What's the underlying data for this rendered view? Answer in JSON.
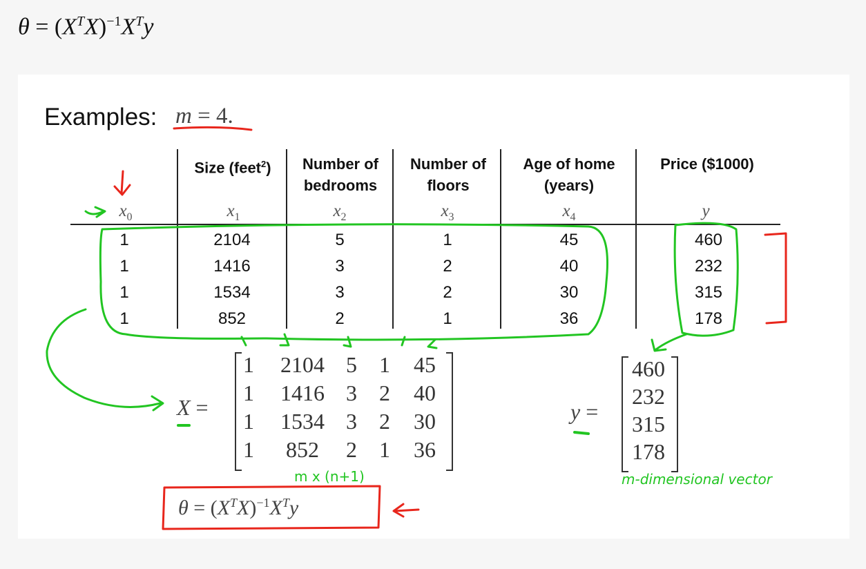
{
  "formula_text": {
    "theta": "θ",
    "eq": " = (",
    "x1": "X",
    "t1": "T",
    "x2": "X",
    "close": ")",
    "inv": "−1",
    "x3": "X",
    "t2": "T",
    "y": "y"
  },
  "slide": {
    "examples_label": "Examples:",
    "m_var": "m",
    "m_eq": " = 4."
  },
  "table": {
    "headers": [
      {
        "line1": "",
        "line2": "",
        "symbol": "x",
        "sub": "0"
      },
      {
        "line1": "Size (feet",
        "sup": "2",
        "line1_end": ")",
        "line2": "",
        "symbol": "x",
        "sub": "1"
      },
      {
        "line1": "Number of",
        "line2": "bedrooms",
        "symbol": "x",
        "sub": "2"
      },
      {
        "line1": "Number of",
        "line2": "floors",
        "symbol": "x",
        "sub": "3"
      },
      {
        "line1": "Age of home",
        "line2": "(years)",
        "symbol": "x",
        "sub": "4"
      },
      {
        "line1": "Price ($1000)",
        "line2": "",
        "symbol": "y",
        "sub": ""
      }
    ],
    "rows": [
      [
        "1",
        "2104",
        "5",
        "1",
        "45",
        "460"
      ],
      [
        "1",
        "1416",
        "3",
        "2",
        "40",
        "232"
      ],
      [
        "1",
        "1534",
        "3",
        "2",
        "30",
        "315"
      ],
      [
        "1",
        "852",
        "2",
        "1",
        "36",
        "178"
      ]
    ]
  },
  "matrix_X": {
    "label": "X",
    "eq": "=",
    "rows": [
      [
        "1",
        "2104",
        "5",
        "1",
        "45"
      ],
      [
        "1",
        "1416",
        "3",
        "2",
        "40"
      ],
      [
        "1",
        "1534",
        "3",
        "2",
        "30"
      ],
      [
        "1",
        "852",
        "2",
        "1",
        "36"
      ]
    ]
  },
  "vector_y": {
    "label": "y",
    "eq": "=",
    "values": [
      "460",
      "232",
      "315",
      "178"
    ]
  },
  "annotations": {
    "x_dims": "m x (n+1)",
    "y_dims": "m-dimensional vector"
  },
  "bottom_formula": {
    "theta": "θ",
    "eq": " = (",
    "x1": "X",
    "t1": "T",
    "x2": "X",
    "close": ")",
    "inv": "−1",
    "x3": "X",
    "t2": "T",
    "y": "y"
  },
  "colors": {
    "green_ink": "#22c522",
    "red_ink": "#e8261c"
  }
}
